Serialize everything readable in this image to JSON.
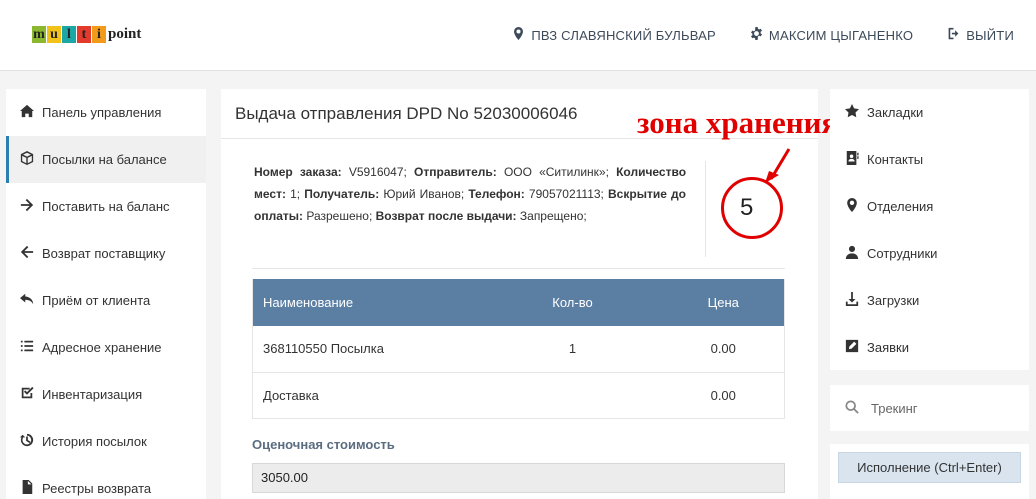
{
  "brand": {
    "letters": [
      "m",
      "u",
      "l",
      "t",
      "i"
    ],
    "letter_colors": [
      "#8bb82e",
      "#f2c21a",
      "#1ca6a6",
      "#e23a2c",
      "#f29a1a"
    ],
    "rest": "point"
  },
  "header": {
    "location": "ПВЗ СЛАВЯНСКИЙ БУЛЬВАР",
    "user": "МАКСИМ ЦЫГАНЕНКО",
    "logout": "ВЫЙТИ"
  },
  "sidebar": {
    "items": [
      {
        "label": "Панель управления",
        "icon": "home-icon"
      },
      {
        "label": "Посылки на балансе",
        "icon": "box-icon",
        "active": true
      },
      {
        "label": "Поставить на баланс",
        "icon": "arrow-right-icon"
      },
      {
        "label": "Возврат поставщику",
        "icon": "arrow-left-icon"
      },
      {
        "label": "Приём от клиента",
        "icon": "reply-icon"
      },
      {
        "label": "Адресное хранение",
        "icon": "list-icon"
      },
      {
        "label": "Инвентаризация",
        "icon": "checkbox-icon"
      },
      {
        "label": "История посылок",
        "icon": "history-icon"
      },
      {
        "label": "Реестры возврата",
        "icon": "file-icon"
      }
    ]
  },
  "main": {
    "title": "Выдача отправления DPD No 52030006046",
    "fields": {
      "order_label": "Номер заказа:",
      "order": "V5916047;",
      "sender_label": "Отправитель:",
      "sender": "ООО «Ситилинк»;",
      "places_label": "Количество мест:",
      "places": "1;",
      "recipient_label": "Получатель:",
      "recipient": "Юрий Иванов;",
      "phone_label": "Телефон:",
      "phone": "79057021113;",
      "open_label": "Вскрытие до оплаты:",
      "open": "Разрешено;",
      "return_label": "Возврат после выдачи:",
      "return": "Запрещено;"
    },
    "annotation": "зона хранения",
    "storage_zone": "5",
    "table": {
      "headers": [
        "Наименование",
        "Кол-во",
        "Цена"
      ],
      "rows": [
        [
          "368110550 Посылка",
          "1",
          "0.00"
        ],
        [
          "Доставка",
          "",
          "0.00"
        ]
      ]
    },
    "cost_label": "Оценочная стоимость",
    "cost_value": "3050.00"
  },
  "rightbar": {
    "items": [
      {
        "label": "Закладки",
        "icon": "star-icon"
      },
      {
        "label": "Контакты",
        "icon": "contacts-icon"
      },
      {
        "label": "Отделения",
        "icon": "map-marker-icon"
      },
      {
        "label": "Сотрудники",
        "icon": "user-icon"
      },
      {
        "label": "Загрузки",
        "icon": "download-icon"
      },
      {
        "label": "Заявки",
        "icon": "edit-icon"
      }
    ],
    "tracking_placeholder": "Трекинг",
    "execute_button": "Исполнение (Ctrl+Enter)"
  },
  "colors": {
    "accent_red": "#e00000",
    "table_header": "#5b7fa3",
    "nav_text": "#3c4a5a"
  }
}
